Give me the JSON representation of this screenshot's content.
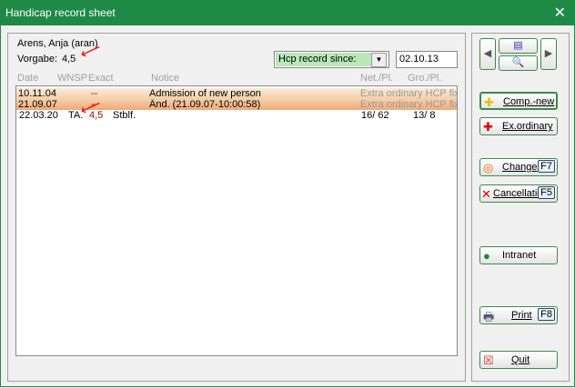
{
  "window": {
    "title": "Handicap record sheet"
  },
  "player": {
    "name": "Arens, Anja (aran)",
    "vorgabe_label": "Vorgabe:",
    "vorgabe": "4,5"
  },
  "filter": {
    "select": "Hcp record since:",
    "date": "02.10.13"
  },
  "columns": [
    "Date",
    "WNSP",
    "Exact",
    "Notice",
    "Net./Pl.",
    "Gro./Pl."
  ],
  "rows": [
    {
      "date": "10.11.04",
      "wnsp": "",
      "exact": "--",
      "extra": "",
      "notice": "Admission of new person",
      "net": "Extra ordinary HCP fixing",
      "gro": ""
    },
    {
      "date": "21.09.07",
      "wnsp": "",
      "exact": "--",
      "extra": "",
      "notice": "Änd. (21.09.07-10:00:58)",
      "net": "Extra ordinary HCP fixing",
      "gro": ""
    },
    {
      "date": "22.03.20",
      "wnsp": "TA.",
      "exact": "4,5",
      "extra": "Stblf.",
      "notice": "",
      "net": "16/ 62",
      "gro": "13/ 8"
    }
  ],
  "buttons": {
    "comp_new": "Comp.-new",
    "ex_ordinary": "Ex.ordinary",
    "change": "Change",
    "change_key": "F7",
    "cancel": "Cancellation",
    "cancel_key": "F5",
    "intranet": "Intranet",
    "print": "Print",
    "print_key": "F8",
    "quit": "Quit"
  }
}
